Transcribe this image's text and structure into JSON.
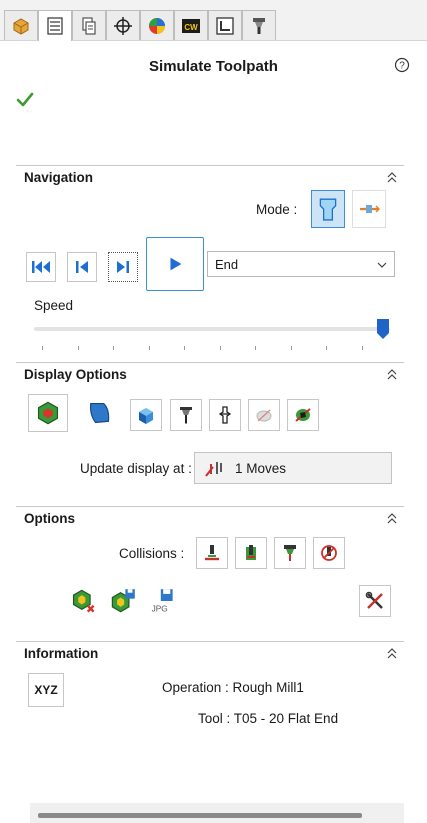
{
  "tabs": [
    {
      "icon": "part-icon",
      "active": false
    },
    {
      "icon": "property-list-icon",
      "active": true
    },
    {
      "icon": "configuration-icon",
      "active": false
    },
    {
      "icon": "crosshair-icon",
      "active": false
    },
    {
      "icon": "appearance-icon",
      "active": false
    },
    {
      "icon": "cam-icon",
      "text": "CW",
      "active": false
    },
    {
      "icon": "cam-tree-icon",
      "active": false
    },
    {
      "icon": "tool-holder-icon",
      "active": false
    }
  ],
  "panel": {
    "title": "Simulate Toolpath"
  },
  "navigation": {
    "header": "Navigation",
    "mode_label": "Mode :",
    "end_select": "End",
    "speed_label": "Speed",
    "speed_level": 1.0
  },
  "display_options": {
    "header": "Display Options",
    "update_label": "Update display at :",
    "update_value": "1 Moves"
  },
  "options": {
    "header": "Options",
    "collisions_label": "Collisions :",
    "jpg_text": "JPG"
  },
  "information": {
    "header": "Information",
    "xyz_label": "XYZ",
    "operation": "Operation : Rough Mill1",
    "tool": "Tool : T05 - 20 Flat End"
  },
  "colors": {
    "accent_blue": "#1f6fd1",
    "check_green": "#3b9c2d",
    "slider_blue": "#1e63c8"
  }
}
